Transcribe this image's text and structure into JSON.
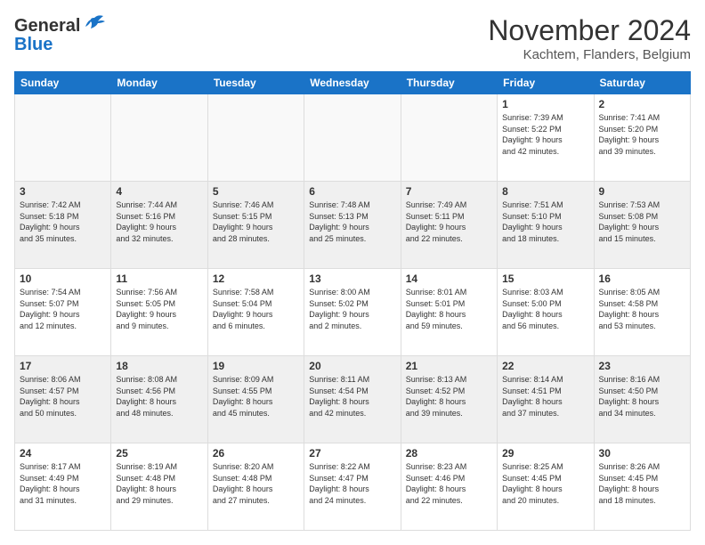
{
  "logo": {
    "line1": "General",
    "line2": "Blue"
  },
  "title": "November 2024",
  "subtitle": "Kachtem, Flanders, Belgium",
  "days_header": [
    "Sunday",
    "Monday",
    "Tuesday",
    "Wednesday",
    "Thursday",
    "Friday",
    "Saturday"
  ],
  "weeks": [
    [
      {
        "day": "",
        "info": ""
      },
      {
        "day": "",
        "info": ""
      },
      {
        "day": "",
        "info": ""
      },
      {
        "day": "",
        "info": ""
      },
      {
        "day": "",
        "info": ""
      },
      {
        "day": "1",
        "info": "Sunrise: 7:39 AM\nSunset: 5:22 PM\nDaylight: 9 hours\nand 42 minutes."
      },
      {
        "day": "2",
        "info": "Sunrise: 7:41 AM\nSunset: 5:20 PM\nDaylight: 9 hours\nand 39 minutes."
      }
    ],
    [
      {
        "day": "3",
        "info": "Sunrise: 7:42 AM\nSunset: 5:18 PM\nDaylight: 9 hours\nand 35 minutes."
      },
      {
        "day": "4",
        "info": "Sunrise: 7:44 AM\nSunset: 5:16 PM\nDaylight: 9 hours\nand 32 minutes."
      },
      {
        "day": "5",
        "info": "Sunrise: 7:46 AM\nSunset: 5:15 PM\nDaylight: 9 hours\nand 28 minutes."
      },
      {
        "day": "6",
        "info": "Sunrise: 7:48 AM\nSunset: 5:13 PM\nDaylight: 9 hours\nand 25 minutes."
      },
      {
        "day": "7",
        "info": "Sunrise: 7:49 AM\nSunset: 5:11 PM\nDaylight: 9 hours\nand 22 minutes."
      },
      {
        "day": "8",
        "info": "Sunrise: 7:51 AM\nSunset: 5:10 PM\nDaylight: 9 hours\nand 18 minutes."
      },
      {
        "day": "9",
        "info": "Sunrise: 7:53 AM\nSunset: 5:08 PM\nDaylight: 9 hours\nand 15 minutes."
      }
    ],
    [
      {
        "day": "10",
        "info": "Sunrise: 7:54 AM\nSunset: 5:07 PM\nDaylight: 9 hours\nand 12 minutes."
      },
      {
        "day": "11",
        "info": "Sunrise: 7:56 AM\nSunset: 5:05 PM\nDaylight: 9 hours\nand 9 minutes."
      },
      {
        "day": "12",
        "info": "Sunrise: 7:58 AM\nSunset: 5:04 PM\nDaylight: 9 hours\nand 6 minutes."
      },
      {
        "day": "13",
        "info": "Sunrise: 8:00 AM\nSunset: 5:02 PM\nDaylight: 9 hours\nand 2 minutes."
      },
      {
        "day": "14",
        "info": "Sunrise: 8:01 AM\nSunset: 5:01 PM\nDaylight: 8 hours\nand 59 minutes."
      },
      {
        "day": "15",
        "info": "Sunrise: 8:03 AM\nSunset: 5:00 PM\nDaylight: 8 hours\nand 56 minutes."
      },
      {
        "day": "16",
        "info": "Sunrise: 8:05 AM\nSunset: 4:58 PM\nDaylight: 8 hours\nand 53 minutes."
      }
    ],
    [
      {
        "day": "17",
        "info": "Sunrise: 8:06 AM\nSunset: 4:57 PM\nDaylight: 8 hours\nand 50 minutes."
      },
      {
        "day": "18",
        "info": "Sunrise: 8:08 AM\nSunset: 4:56 PM\nDaylight: 8 hours\nand 48 minutes."
      },
      {
        "day": "19",
        "info": "Sunrise: 8:09 AM\nSunset: 4:55 PM\nDaylight: 8 hours\nand 45 minutes."
      },
      {
        "day": "20",
        "info": "Sunrise: 8:11 AM\nSunset: 4:54 PM\nDaylight: 8 hours\nand 42 minutes."
      },
      {
        "day": "21",
        "info": "Sunrise: 8:13 AM\nSunset: 4:52 PM\nDaylight: 8 hours\nand 39 minutes."
      },
      {
        "day": "22",
        "info": "Sunrise: 8:14 AM\nSunset: 4:51 PM\nDaylight: 8 hours\nand 37 minutes."
      },
      {
        "day": "23",
        "info": "Sunrise: 8:16 AM\nSunset: 4:50 PM\nDaylight: 8 hours\nand 34 minutes."
      }
    ],
    [
      {
        "day": "24",
        "info": "Sunrise: 8:17 AM\nSunset: 4:49 PM\nDaylight: 8 hours\nand 31 minutes."
      },
      {
        "day": "25",
        "info": "Sunrise: 8:19 AM\nSunset: 4:48 PM\nDaylight: 8 hours\nand 29 minutes."
      },
      {
        "day": "26",
        "info": "Sunrise: 8:20 AM\nSunset: 4:48 PM\nDaylight: 8 hours\nand 27 minutes."
      },
      {
        "day": "27",
        "info": "Sunrise: 8:22 AM\nSunset: 4:47 PM\nDaylight: 8 hours\nand 24 minutes."
      },
      {
        "day": "28",
        "info": "Sunrise: 8:23 AM\nSunset: 4:46 PM\nDaylight: 8 hours\nand 22 minutes."
      },
      {
        "day": "29",
        "info": "Sunrise: 8:25 AM\nSunset: 4:45 PM\nDaylight: 8 hours\nand 20 minutes."
      },
      {
        "day": "30",
        "info": "Sunrise: 8:26 AM\nSunset: 4:45 PM\nDaylight: 8 hours\nand 18 minutes."
      }
    ]
  ]
}
